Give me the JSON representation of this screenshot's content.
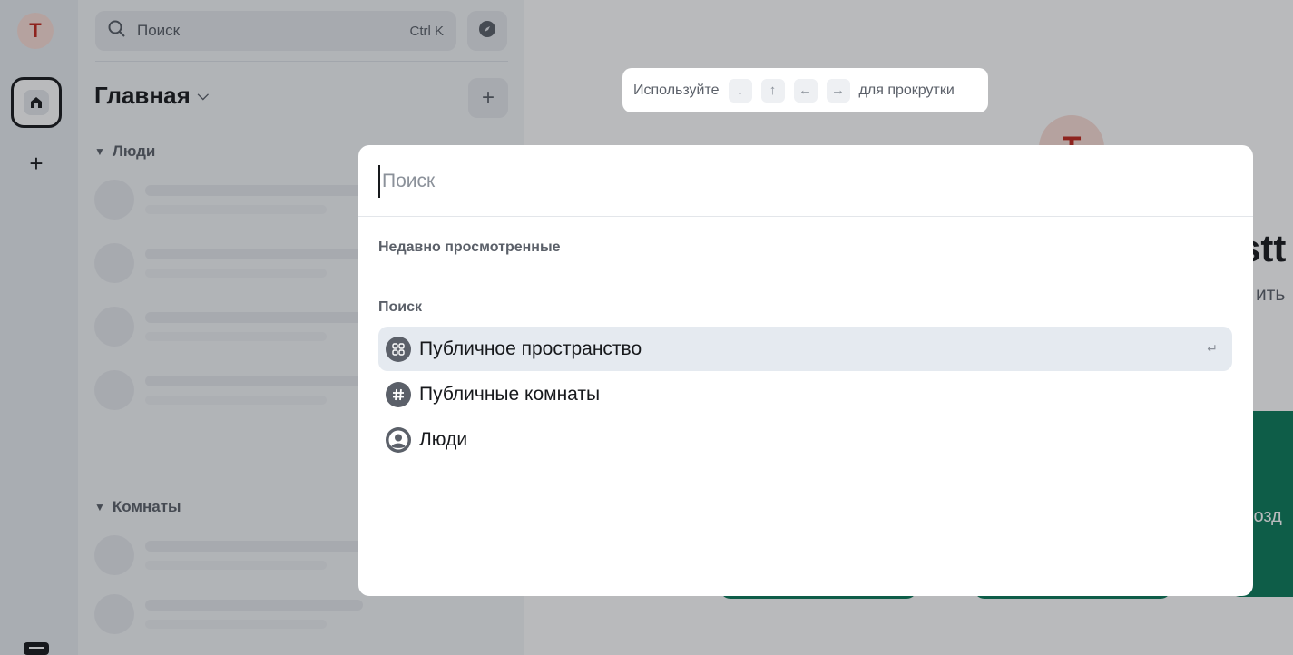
{
  "space_bar": {
    "user_initial": "T",
    "add_space_label": "+"
  },
  "room_list": {
    "search_label": "Поиск",
    "search_shortcut": "Ctrl K",
    "home_title": "Главная",
    "add_label": "+",
    "sections": [
      {
        "label": "Люди"
      },
      {
        "label": "Комнаты"
      }
    ]
  },
  "main": {
    "avatar_initial": "T",
    "welcome_partial": "stt",
    "welcome_sub_partial": "ить",
    "create_partial": "Созд"
  },
  "hint": {
    "prefix": "Используйте",
    "keys": [
      "↓",
      "↑",
      "←",
      "→"
    ],
    "suffix": "для прокрутки"
  },
  "dialog": {
    "search_placeholder": "Поиск",
    "search_value": "",
    "recent_header": "Недавно просмотренные",
    "search_header": "Поиск",
    "options": [
      {
        "label": "Публичное пространство",
        "icon": "spaces-icon",
        "active": true,
        "enter_hint": "↵"
      },
      {
        "label": "Публичные комнаты",
        "icon": "hash-icon",
        "active": false
      },
      {
        "label": "Люди",
        "icon": "user-icon",
        "active": false
      }
    ]
  },
  "colors": {
    "accent_green": "#0b7a5a",
    "avatar_bg": "#faddd6",
    "avatar_fg": "#c2271d",
    "active_option_bg": "#e5eaf0"
  }
}
